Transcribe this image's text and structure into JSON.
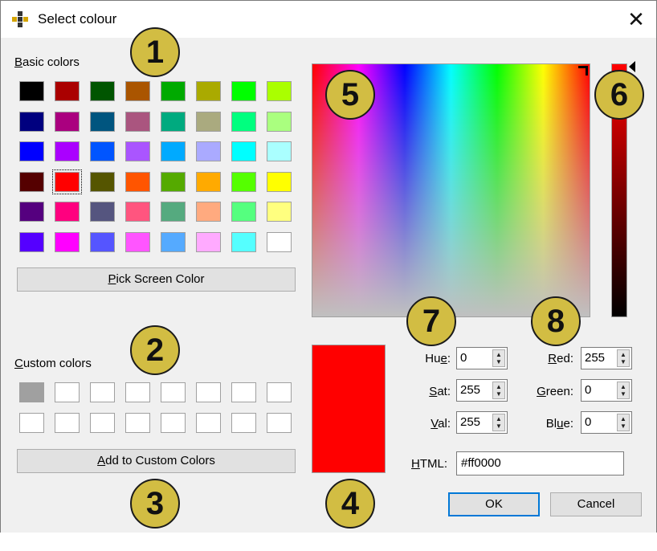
{
  "window": {
    "title": "Select colour",
    "close_glyph": "✕"
  },
  "basic_colors": {
    "label_u": "B",
    "label_rest": "asic colors",
    "swatches": [
      "#000000",
      "#aa0000",
      "#005500",
      "#aa5500",
      "#00aa00",
      "#aaaa00",
      "#00ff00",
      "#aaff00",
      "#00007f",
      "#aa007f",
      "#00557f",
      "#aa557f",
      "#00aa7f",
      "#aaaa7f",
      "#00ff7f",
      "#aaff7f",
      "#0000ff",
      "#aa00ff",
      "#0055ff",
      "#aa55ff",
      "#00aaff",
      "#aaaaff",
      "#00ffff",
      "#aaffff",
      "#550000",
      "#ff0000",
      "#555500",
      "#ff5500",
      "#55aa00",
      "#ffaa00",
      "#55ff00",
      "#ffff00",
      "#55007f",
      "#ff007f",
      "#55557f",
      "#ff557f",
      "#55aa7f",
      "#ffaa7f",
      "#55ff7f",
      "#ffff7f",
      "#5500ff",
      "#ff00ff",
      "#5555ff",
      "#ff55ff",
      "#55aaff",
      "#ffaaff",
      "#55ffff",
      "#ffffff"
    ],
    "selected_index": 25
  },
  "pick_screen": {
    "label_u": "P",
    "label_rest": "ick Screen Color"
  },
  "custom_colors": {
    "label_u": "C",
    "label_rest": "ustom colors",
    "swatches": [
      "#a0a0a0",
      "#ffffff",
      "#ffffff",
      "#ffffff",
      "#ffffff",
      "#ffffff",
      "#ffffff",
      "#ffffff",
      "#ffffff",
      "#ffffff",
      "#ffffff",
      "#ffffff",
      "#ffffff",
      "#ffffff",
      "#ffffff",
      "#ffffff"
    ]
  },
  "add_custom": {
    "label_u": "A",
    "label_rest": "dd to Custom Colors"
  },
  "preview": {
    "color": "#ff0000"
  },
  "fields": {
    "hue": {
      "pre": "Hu",
      "u": "e",
      "post": ":",
      "value": "0"
    },
    "sat": {
      "pre": "",
      "u": "S",
      "post": "at:",
      "value": "255"
    },
    "val": {
      "pre": "",
      "u": "V",
      "post": "al:",
      "value": "255"
    },
    "red": {
      "pre": "",
      "u": "R",
      "post": "ed:",
      "value": "255"
    },
    "green": {
      "pre": "",
      "u": "G",
      "post": "reen:",
      "value": "0"
    },
    "blue": {
      "pre": "Bl",
      "u": "u",
      "post": "e:",
      "value": "0"
    },
    "html": {
      "pre": "",
      "u": "H",
      "post": "TML:",
      "value": "#ff0000"
    }
  },
  "buttons": {
    "ok": "OK",
    "cancel": "Cancel"
  },
  "badges": [
    "1",
    "2",
    "3",
    "4",
    "5",
    "6",
    "7",
    "8"
  ],
  "arrows": {
    "up": "▲",
    "down": "▼"
  }
}
